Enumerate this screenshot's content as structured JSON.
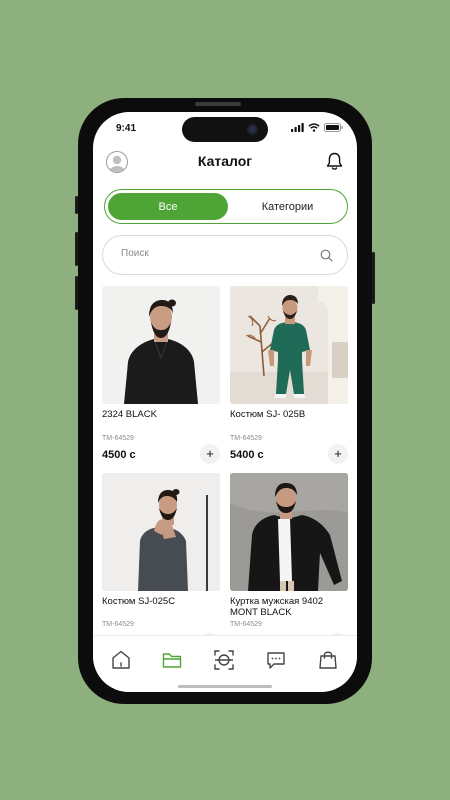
{
  "status_bar": {
    "time": "9:41"
  },
  "header": {
    "title": "Каталог"
  },
  "segment": {
    "active_label": "Все",
    "inactive_label": "Категории"
  },
  "search": {
    "placeholder": "Поиск"
  },
  "products": [
    {
      "name": "2324 BLACK",
      "sku": "TM-64529",
      "price": "4500 с"
    },
    {
      "name": "Костюм SJ- 025B",
      "sku": "TM-64529",
      "price": "5400 с"
    },
    {
      "name": "Костюм SJ-025C",
      "sku": "TM-64529",
      "price": ""
    },
    {
      "name": "Куртка мужская 9402 MONT BLACK",
      "sku": "TM-64529",
      "price": ""
    }
  ],
  "add_label": "+",
  "nav": [
    "home-icon",
    "folder-icon",
    "scan-icon",
    "chat-icon",
    "bag-icon"
  ],
  "colors": {
    "accent": "#4ea535",
    "background": "#8db07e"
  }
}
